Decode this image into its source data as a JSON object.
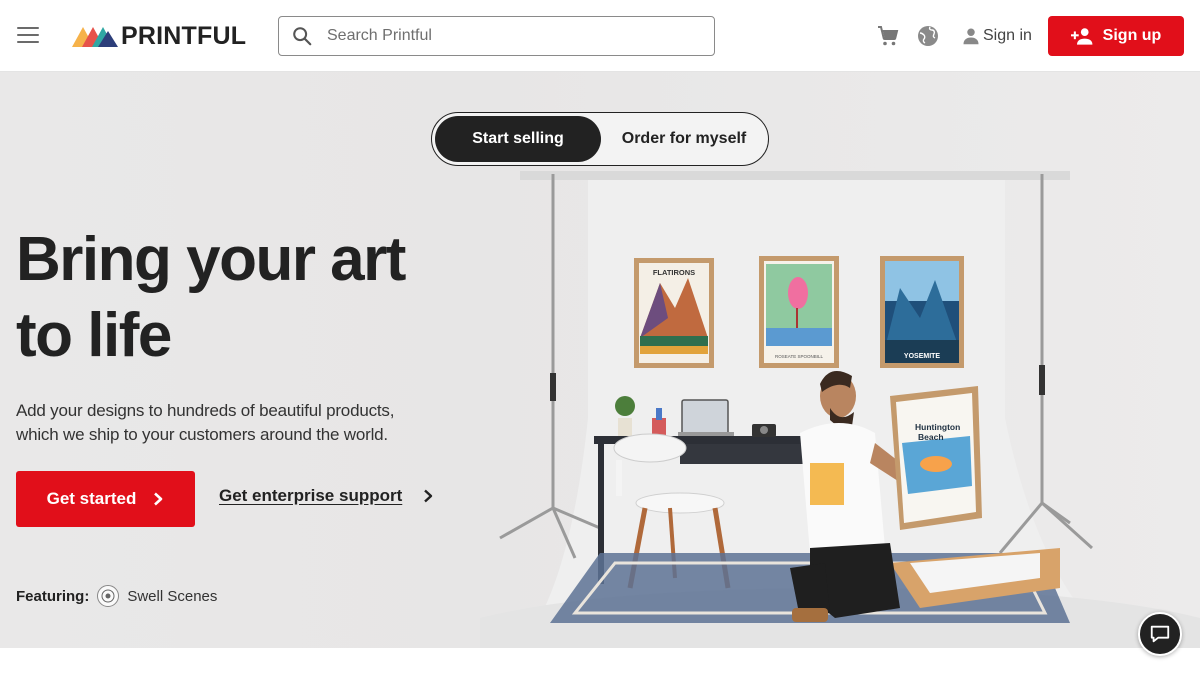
{
  "header": {
    "menu_icon": "hamburger-menu-icon",
    "brand": "PRINTFUL",
    "search_placeholder": "Search Printful",
    "cart_icon": "cart-icon",
    "language_icon": "globe-icon",
    "signin_label": "Sign in",
    "signup_label": "Sign up"
  },
  "hero": {
    "toggle": {
      "active": "Start selling",
      "inactive": "Order for myself"
    },
    "headline_line1": "Bring your art",
    "headline_line2": "to life",
    "subtext": "Add your designs to hundreds of beautiful products, which we ship to your customers around the world.",
    "primary_cta": "Get started",
    "secondary_cta": "Get enterprise support",
    "featuring_label": "Featuring:",
    "featuring_name": "Swell Scenes",
    "posters": [
      "FLATIRONS",
      "ROSEATE SPOONBILL",
      "YOSEMITE"
    ],
    "held_poster": "Huntington Beach"
  },
  "colors": {
    "brand_red": "#e10f1a",
    "dark": "#222222",
    "hero_bg": "#e8e7e7"
  },
  "chat_icon": "chat-bubble-icon"
}
